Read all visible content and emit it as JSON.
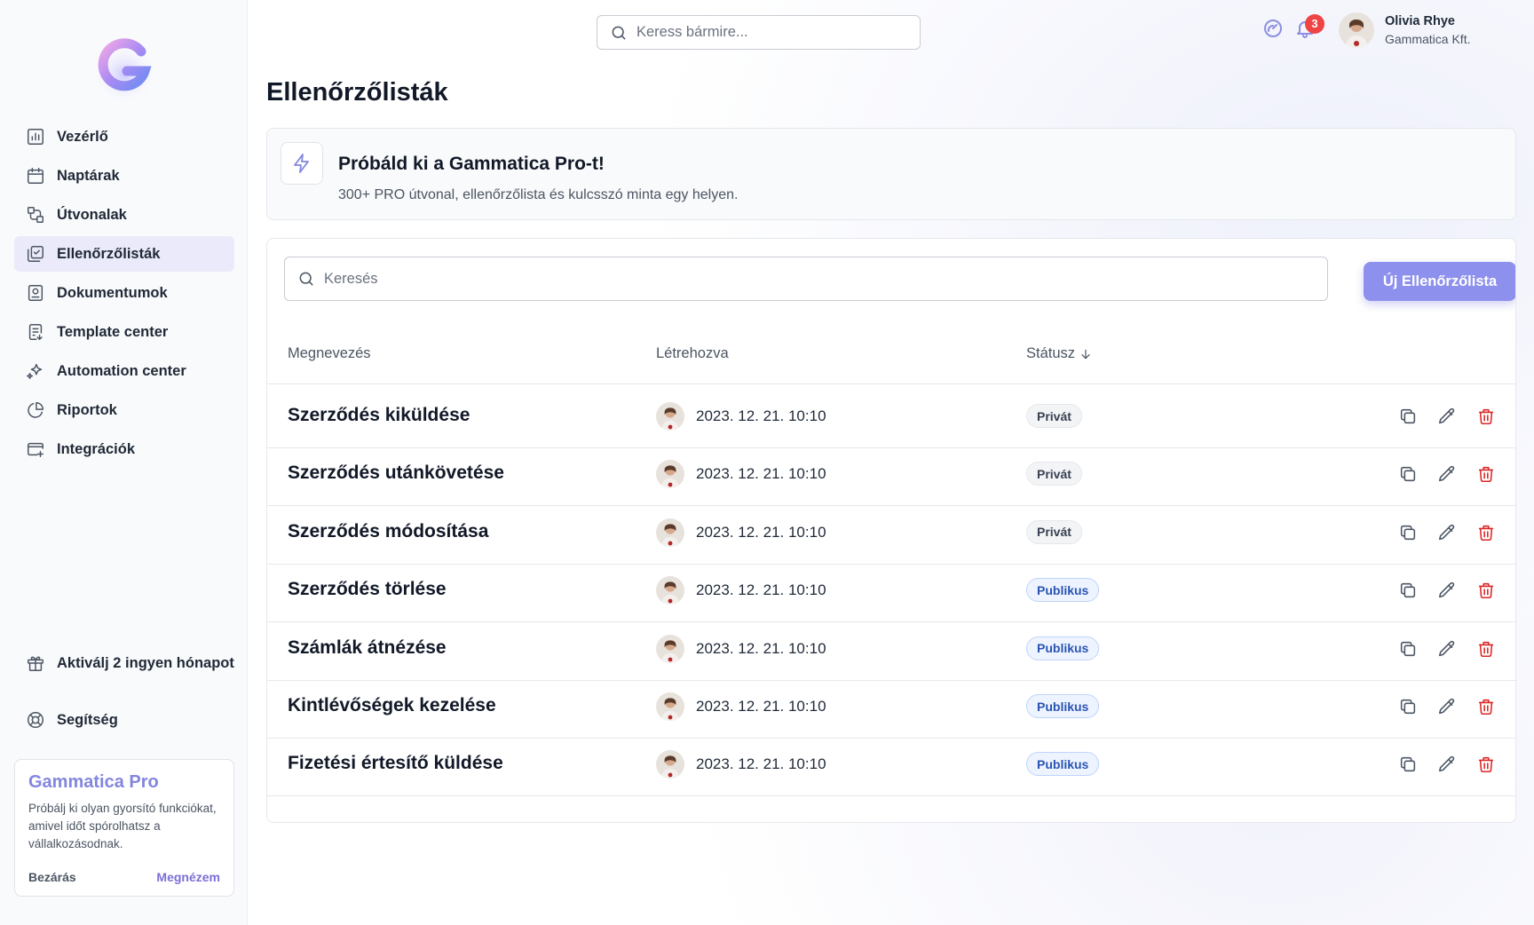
{
  "sidebar": {
    "logo_icon": "gradient-g-logo",
    "nav": [
      {
        "label": "Vezérlő",
        "icon": "bar-chart-icon",
        "active": false
      },
      {
        "label": "Naptárak",
        "icon": "calendar-icon",
        "active": false
      },
      {
        "label": "Útvonalak",
        "icon": "route-icon",
        "active": false
      },
      {
        "label": "Ellenőrzőlisták",
        "icon": "checklist-icon",
        "active": true
      },
      {
        "label": "Dokumentumok",
        "icon": "document-icon",
        "active": false
      },
      {
        "label": "Template center",
        "icon": "template-icon",
        "active": false
      },
      {
        "label": "Automation center",
        "icon": "sparkles-icon",
        "active": false
      },
      {
        "label": "Riportok",
        "icon": "pie-chart-icon",
        "active": false
      },
      {
        "label": "Integrációk",
        "icon": "integration-icon",
        "active": false
      }
    ],
    "activate_label": "Aktiválj 2 ingyen hónapot",
    "help_label": "Segítség",
    "promo": {
      "title": "Gammatica Pro",
      "text": "Próbálj ki olyan gyorsító funkciókat, amivel időt spórolhatsz a vállalkozásodnak.",
      "close_label": "Bezárás",
      "try_label": "Megnézem"
    }
  },
  "header": {
    "search_placeholder": "Keress bármire...",
    "notifications_count": "3",
    "user_name": "Olivia Rhye",
    "user_company": "Gammatica Kft."
  },
  "page": {
    "title": "Ellenőrzőlisták",
    "banner_title": "Próbáld ki a Gammatica Pro-t!",
    "banner_sub": "300+ PRO útvonal, ellenőrzőlista és kulcsszó minta egy helyen.",
    "list_search_placeholder": "Keresés",
    "new_button": "Új Ellenőrzőlista"
  },
  "table": {
    "columns": [
      "Megnevezés",
      "Létrehozva",
      "Státusz"
    ],
    "rows": [
      {
        "name": "Szerződés kiküldése",
        "created": "2023. 12. 21. 10:10",
        "status": "Privát"
      },
      {
        "name": "Szerződés utánkövetése",
        "created": "2023. 12. 21. 10:10",
        "status": "Privát"
      },
      {
        "name": "Szerződés módosítása",
        "created": "2023. 12. 21. 10:10",
        "status": "Privát"
      },
      {
        "name": "Szerződés törlése",
        "created": "2023. 12. 21. 10:10",
        "status": "Publikus"
      },
      {
        "name": "Számlák átnézése",
        "created": "2023. 12. 21. 10:10",
        "status": "Publikus"
      },
      {
        "name": "Kintlévőségek kezelése",
        "created": "2023. 12. 21. 10:10",
        "status": "Publikus"
      },
      {
        "name": "Fizetési értesítő küldése",
        "created": "2023. 12. 21. 10:10",
        "status": "Publikus"
      }
    ]
  },
  "colors": {
    "accent": "#8e90ee",
    "active_nav_bg": "#ebeafb",
    "delete_red": "#dc2626",
    "public_pill": "#2954b3"
  }
}
